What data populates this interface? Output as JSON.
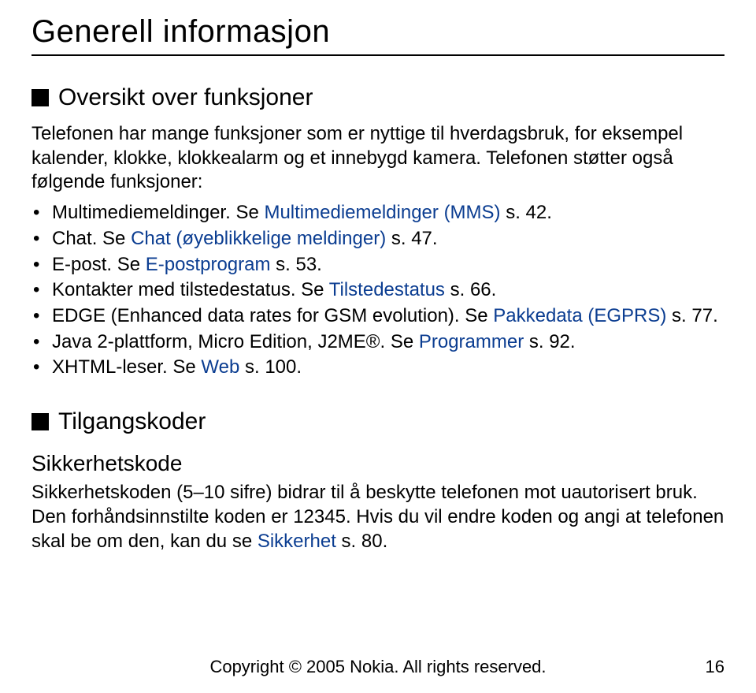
{
  "title": "Generell informasjon",
  "sections": [
    {
      "heading": "Oversikt over funksjoner",
      "intro": "Telefonen har mange funksjoner som er nyttige til hverdagsbruk, for eksempel kalender, klokke, klokkealarm og et innebygd kamera. Telefonen støtter også følgende funksjoner:",
      "items": [
        {
          "pre": "Multimediemeldinger. Se ",
          "link": "Multimediemeldinger (MMS)",
          "post": " s. 42."
        },
        {
          "pre": "Chat. Se ",
          "link": "Chat (øyeblikkelige meldinger)",
          "post": " s. 47."
        },
        {
          "pre": "E-post. Se ",
          "link": "E-postprogram",
          "post": " s. 53."
        },
        {
          "pre": "Kontakter med tilstedestatus. Se ",
          "link": "Tilstedestatus",
          "post": " s. 66."
        },
        {
          "pre": "EDGE (Enhanced data rates for GSM evolution). Se ",
          "link": "Pakkedata (EGPRS)",
          "post": " s. 77."
        },
        {
          "pre": "Java 2-plattform, Micro Edition, J2ME®. Se ",
          "link": "Programmer",
          "post": " s. 92."
        },
        {
          "pre": "XHTML-leser. Se ",
          "link": "Web",
          "post": " s. 100."
        }
      ]
    },
    {
      "heading": "Tilgangskoder",
      "sub": {
        "title": "Sikkerhetskode",
        "body_pre": "Sikkerhetskoden (5–10 sifre) bidrar til å beskytte telefonen mot uautorisert bruk. Den forhåndsinnstilte koden er 12345. Hvis du vil endre koden og angi at telefonen skal be om den, kan du se ",
        "body_link": "Sikkerhet",
        "body_post": " s. 80."
      }
    }
  ],
  "footer": "Copyright © 2005 Nokia. All rights reserved.",
  "page_number": "16"
}
